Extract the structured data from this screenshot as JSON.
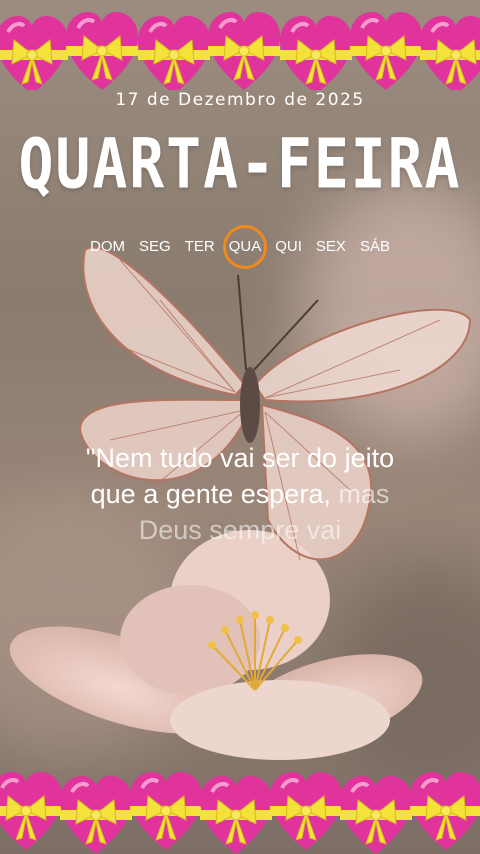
{
  "date_line": "17 de Dezembro de 2025",
  "day_title": "QUARTA-FEIRA",
  "weekdays": [
    {
      "label": "DOM",
      "active": false
    },
    {
      "label": "SEG",
      "active": false
    },
    {
      "label": "TER",
      "active": false
    },
    {
      "label": "QUA",
      "active": true
    },
    {
      "label": "QUI",
      "active": false
    },
    {
      "label": "SEX",
      "active": false
    },
    {
      "label": "SÁB",
      "active": false
    }
  ],
  "quote": {
    "line1": "\"Nem tudo vai ser do jeito",
    "line2_main": "que a gente espera, ",
    "line2_fade": "mas",
    "line3": "Deus sempre vai"
  },
  "colors": {
    "heart": "#e0339c",
    "ribbon": "#f3e23a",
    "active_ring": "#f08a1c"
  },
  "icons": [
    "heart-with-ribbon-icon",
    "butterfly",
    "flower"
  ]
}
